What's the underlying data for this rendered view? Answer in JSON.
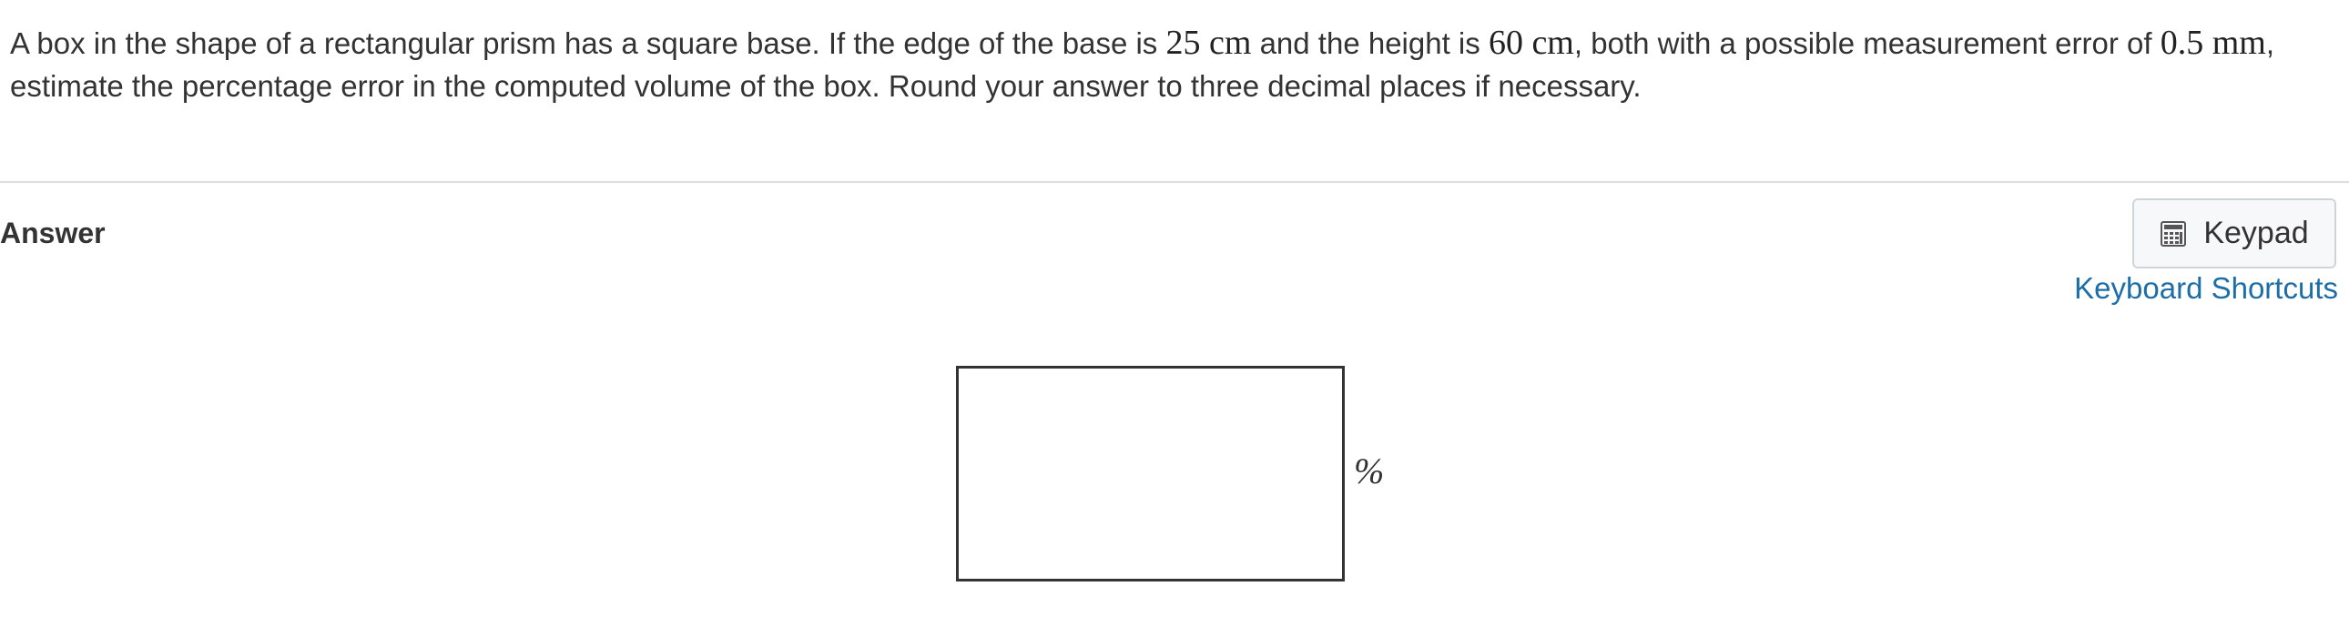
{
  "question": {
    "t1": "A box in the shape of a rectangular prism has a square base. If the edge of the base is ",
    "m1": "25 cm",
    "t2": " and the height is ",
    "m2": "60 cm",
    "t3": ", both with a possible measurement error of ",
    "m3": "0.5 mm",
    "t4": ", estimate the percentage error in the computed volume of the box. Round your answer to three decimal places if necessary."
  },
  "answer": {
    "label": "Answer",
    "input_value": "",
    "unit": "%"
  },
  "toolbar": {
    "keypad_label": "Keypad",
    "keypad_icon": "calculator-icon",
    "shortcuts_label": "Keyboard Shortcuts"
  },
  "colors": {
    "link": "#1d6ea8",
    "divider": "#dddddd",
    "text": "#333333"
  }
}
